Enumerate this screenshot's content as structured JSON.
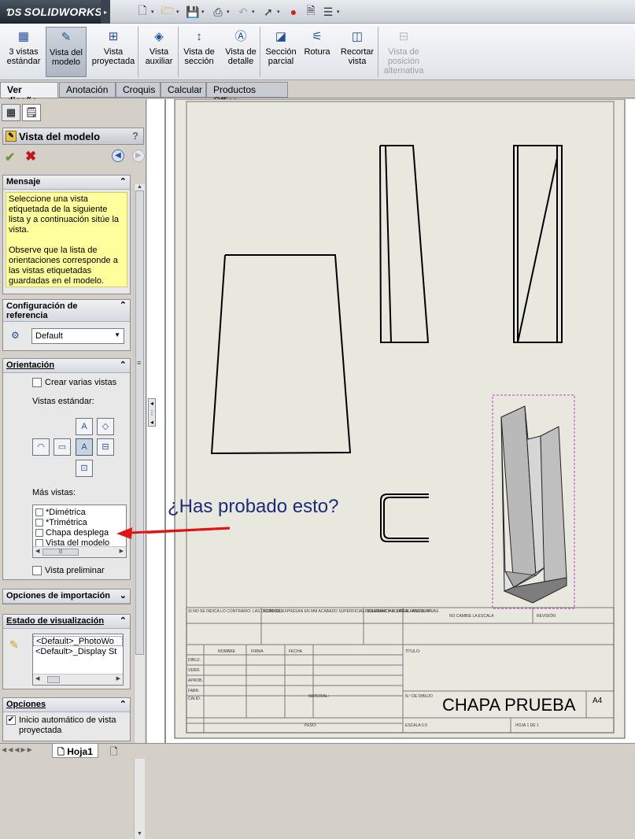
{
  "app": {
    "brand": "SOLIDWORKS"
  },
  "toolbar": {
    "items": [
      {
        "label": "3 vistas estándar",
        "lines": [
          "3 vistas",
          "estándar"
        ],
        "icon": "three-views-icon"
      },
      {
        "label": "Vista del modelo",
        "lines": [
          "Vista del",
          "modelo"
        ],
        "icon": "model-view-icon",
        "active": true
      },
      {
        "label": "Vista proyectada",
        "lines": [
          "Vista",
          "proyectada"
        ],
        "icon": "projected-view-icon"
      },
      {
        "label": "Vista auxiliar",
        "lines": [
          "Vista",
          "auxiliar"
        ],
        "icon": "auxiliary-view-icon"
      },
      {
        "label": "Vista de sección",
        "lines": [
          "Vista de",
          "sección"
        ],
        "icon": "section-view-icon"
      },
      {
        "label": "Vista de detalle",
        "lines": [
          "Vista de",
          "detalle"
        ],
        "icon": "detail-view-icon"
      },
      {
        "label": "Sección parcial",
        "lines": [
          "Sección",
          "parcial"
        ],
        "icon": "broken-out-section-icon"
      },
      {
        "label": "Rotura",
        "lines": [
          "Rotura"
        ],
        "icon": "break-icon"
      },
      {
        "label": "Recortar vista",
        "lines": [
          "Recortar",
          "vista"
        ],
        "icon": "crop-view-icon"
      },
      {
        "label": "Vista de posición alternativa",
        "lines": [
          "Vista de",
          "posición",
          "alternativa"
        ],
        "icon": "alternate-position-icon",
        "disabled": true
      }
    ]
  },
  "tabs": [
    "Ver diseño",
    "Anotación",
    "Croquis",
    "Calcular",
    "Productos Office"
  ],
  "property_manager": {
    "title": "Vista del modelo",
    "help": "?",
    "mensaje": {
      "header": "Mensaje",
      "text1": "Seleccione una vista etiquetada de la siguiente lista y a continuación sitúe la vista.",
      "text2": "Observe que la lista de orientaciones corresponde a las vistas etiquetadas guardadas en el modelo."
    },
    "config": {
      "header1": "Configuración de",
      "header2": "referencia",
      "value": "Default"
    },
    "orientation": {
      "header": "Orientación",
      "create_multiple": "Crear varias vistas",
      "standard_views": "Vistas estándar:",
      "more_views": "Más vistas:",
      "more_views_items": [
        "*Dimétrica",
        "*Trimétrica",
        "Chapa desplega",
        "Vista del modelo"
      ],
      "preview": "Vista preliminar"
    },
    "import_options": {
      "header": "Opciones de importación"
    },
    "display_state": {
      "header": "Estado de visualización",
      "items": [
        "<Default>_PhotoWo",
        "<Default>_Display St"
      ]
    },
    "options": {
      "header": "Opciones",
      "auto_start": "Inicio automático de vista proyectada"
    }
  },
  "sheet_tab": "Hoja1",
  "annotation": "¿Has probado esto?",
  "title_block": {
    "part_title": "CHAPA PRUEBA",
    "size": "A4",
    "notes": "SI NO SE INDICA LO CONTRARIO: LAS COTAS SE EXPRESAN EN MM ACABADO SUPERFICIAL: TOLERANCIAS: LINEAL: ANGULAR:",
    "acabado": "ACABADO:",
    "rebabas": "REBARBAR Y ROMPER ARISTAS VIVAS",
    "no_escala": "NO CAMBIE LA ESCALA",
    "revision": "REVISIÓN",
    "nombre": "NOMBRE",
    "firma": "FIRMA",
    "fecha": "FECHA",
    "titulo": "TÍTULO:",
    "dibuj": "DIBUJ.",
    "verif": "VERIF.",
    "aprob": "APROB.",
    "fabr": "FABR.",
    "calid": "CALID.",
    "material": "MATERIAL:",
    "n_dibujo": "N.º DE DIBUJO",
    "peso": "PESO:",
    "escala": "ESCALA:1:5",
    "hoja": "HOJA 1 DE 1"
  },
  "colors": {
    "accent": "#23509a",
    "message_bg": "#fffe9c",
    "sheet_bg": "#e9e8df",
    "arrow": "#e01414",
    "selection": "#c23bd0"
  }
}
